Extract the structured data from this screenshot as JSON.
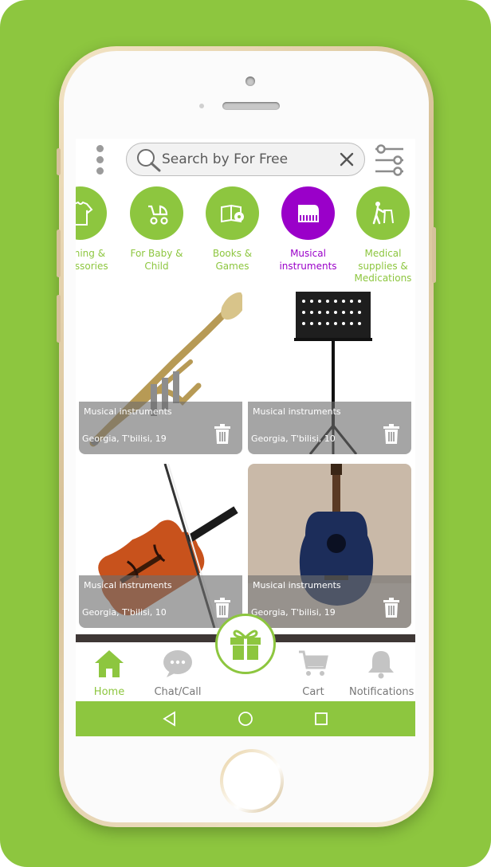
{
  "colors": {
    "accent": "#8dc63f",
    "active_category": "#9a00c9",
    "tab_inactive": "#777777"
  },
  "search": {
    "placeholder": "Search by For Free"
  },
  "categories": [
    {
      "label": "Clothing & Accessories",
      "icon": "clothing-icon",
      "active": false
    },
    {
      "label": "For Baby & Child",
      "icon": "stroller-icon",
      "active": false
    },
    {
      "label": "Books & Games",
      "icon": "books-games-icon",
      "active": false
    },
    {
      "label": "Musical instruments",
      "icon": "piano-icon",
      "active": true
    },
    {
      "label": "Medical supplies & Medications",
      "icon": "walker-icon",
      "active": false
    }
  ],
  "listings": [
    {
      "category": "Musical instruments",
      "location": "Georgia, T'bilisi, 19",
      "image": "trumpet"
    },
    {
      "category": "Musical instruments",
      "location": "Georgia, T'bilisi, 10",
      "image": "music-stand"
    },
    {
      "category": "Musical instruments",
      "location": "Georgia, T'bilisi, 10",
      "image": "violin"
    },
    {
      "category": "Musical instruments",
      "location": "Georgia, T'bilisi, 19",
      "image": "acoustic-guitar"
    }
  ],
  "tabs": [
    {
      "label": "Home",
      "icon": "home-icon",
      "active": true
    },
    {
      "label": "Chat/Call",
      "icon": "chat-icon",
      "active": false
    },
    {
      "label": "Cart",
      "icon": "cart-icon",
      "active": false
    },
    {
      "label": "Notifications",
      "icon": "bell-icon",
      "active": false
    }
  ],
  "center_action": {
    "icon": "gift-icon"
  },
  "system_nav": [
    "back-icon",
    "home-circle-icon",
    "recents-icon"
  ]
}
